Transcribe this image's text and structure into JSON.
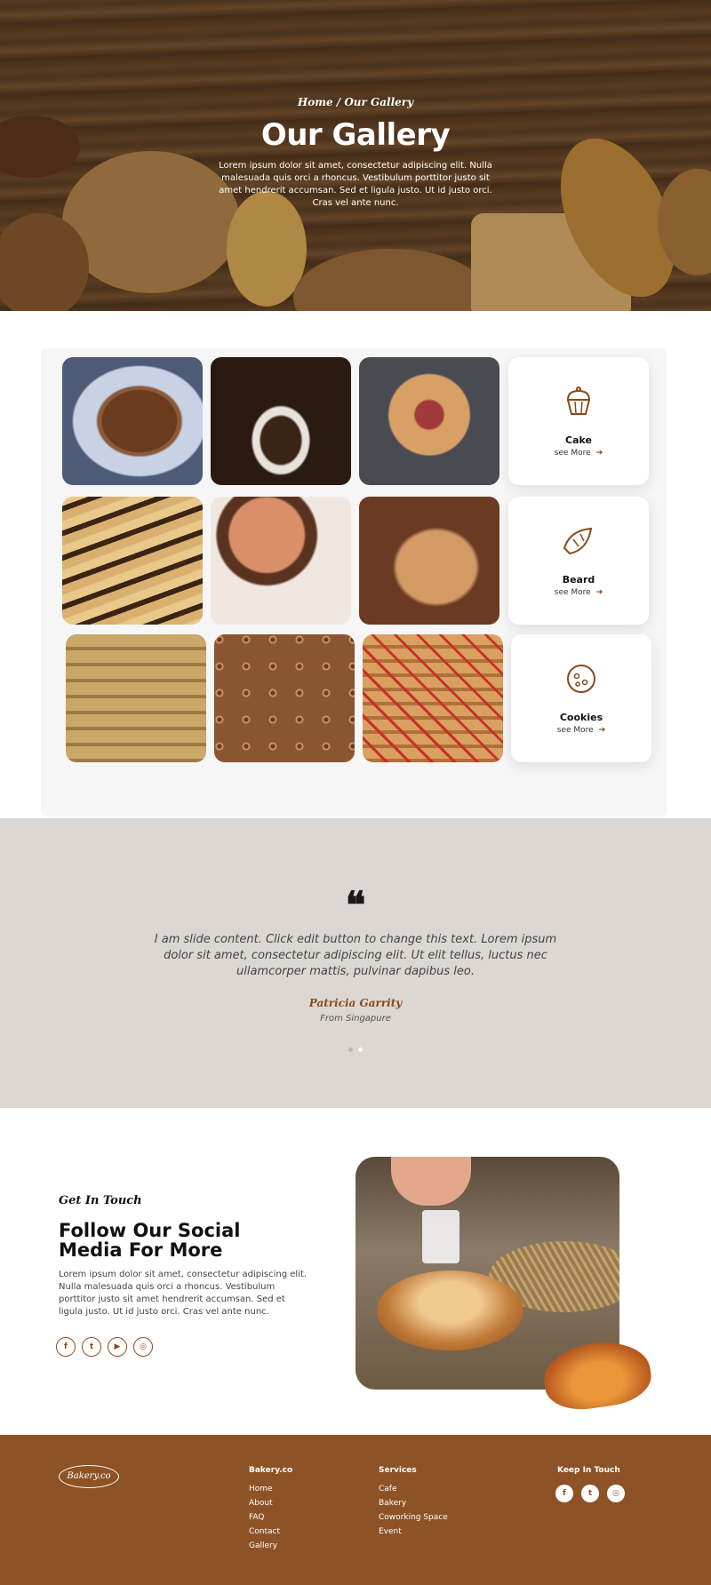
{
  "hero": {
    "breadcrumb": "Home /  Our Gallery",
    "title": "Our Gallery",
    "text": "Lorem ipsum dolor sit amet, consectetur adipiscing elit. Nulla malesuada quis orci a rhoncus. Vestibulum porttitor justo sit amet hendrerit accumsan. Sed et ligula justo. Ut id justo orci. Cras vel ante nunc."
  },
  "gallery": {
    "categories": [
      {
        "name": "Cake",
        "more": "see More",
        "icon": "cupcake-icon"
      },
      {
        "name": "Beard",
        "more": "see More",
        "icon": "croissant-icon"
      },
      {
        "name": "Cookies",
        "more": "see More",
        "icon": "cookie-icon"
      }
    ],
    "photos": [
      "chocolate-cake",
      "bundt-cake",
      "fruit-galette",
      "marble-bread",
      "round-breads",
      "croissant-bread",
      "oat-cookies",
      "thumbprint-cookies",
      "stacked-cookies"
    ]
  },
  "testimonial": {
    "quote_mark": "❝",
    "text": "I am slide content. Click edit button to change this text. Lorem ipsum dolor sit amet, consectetur adipiscing elit. Ut elit tellus, luctus nec ullamcorper mattis, pulvinar dapibus leo.",
    "name": "Patricia Garrity",
    "from": "From Singapure",
    "slides": 2,
    "active_slide": 2
  },
  "social": {
    "tag": "Get In Touch",
    "title": "Follow Our Social Media For More",
    "text": "Lorem ipsum dolor sit amet, consectetur adipiscing elit. Nulla malesuada quis orci a rhoncus. Vestibulum porttitor justo sit amet hendrerit accumsan. Sed et ligula justo. Ut id justo orci. Cras vel ante nunc.",
    "icons": [
      "facebook-icon",
      "twitter-icon",
      "youtube-icon",
      "instagram-icon"
    ],
    "glyphs": [
      "f",
      "t",
      "▶",
      "◎"
    ]
  },
  "footer": {
    "logo": "Bakery.co",
    "col1": {
      "title": "Bakery.co",
      "links": [
        "Home",
        "About",
        "FAQ",
        "Contact",
        "Gallery"
      ]
    },
    "col2": {
      "title": "Services",
      "links": [
        "Cafe",
        "Bakery",
        "Coworking Space",
        "Event"
      ]
    },
    "col3": {
      "title": "Keep In Touch",
      "glyphs": [
        "f",
        "t",
        "◎"
      ]
    }
  },
  "colors": {
    "brand": "#8d5326",
    "accent": "#7a3f10",
    "testimonial_bg": "#dcd7d2"
  }
}
